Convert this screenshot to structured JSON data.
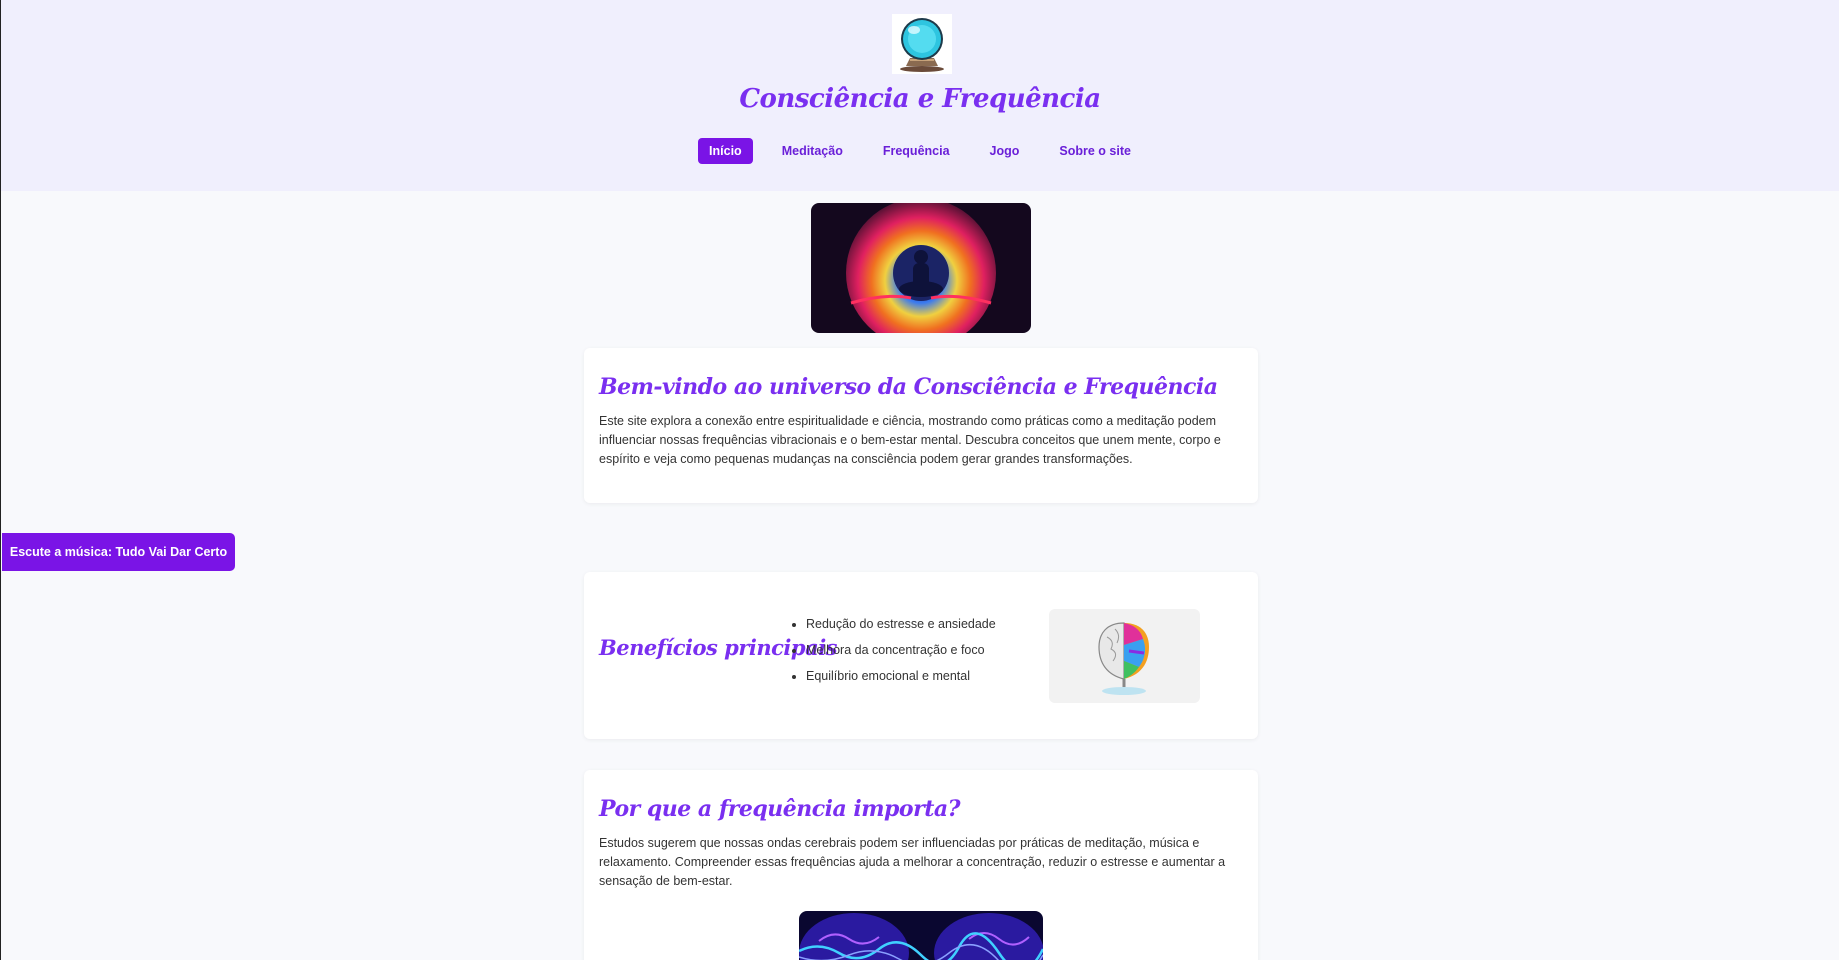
{
  "header": {
    "title": "Consciência e Frequência",
    "logo_icon": "crystal-ball-icon"
  },
  "nav": {
    "items": [
      {
        "label": "Início",
        "active": true
      },
      {
        "label": "Meditação",
        "active": false
      },
      {
        "label": "Frequência",
        "active": false
      },
      {
        "label": "Jogo",
        "active": false
      },
      {
        "label": "Sobre o site",
        "active": false
      }
    ]
  },
  "intro": {
    "title": "Bem-vindo ao universo da Consciência e Frequência",
    "text": "Este site explora a conexão entre espiritualidade e ciência, mostrando como práticas como a meditação podem influenciar nossas frequências vibracionais e o bem-estar mental. Descubra conceitos que unem mente, corpo e espírito e veja como pequenas mudanças na consciência podem gerar grandes transformações."
  },
  "benefits": {
    "title": "Benefícios principais",
    "items": [
      "Redução do estresse e ansiedade",
      "Melhora da concentração e foco",
      "Equilíbrio emocional e mental"
    ]
  },
  "frequency": {
    "title": "Por que a frequência importa?",
    "text": "Estudos sugerem que nossas ondas cerebrais podem ser influenciadas por práticas de meditação, música e relaxamento. Compreender essas frequências ajuda a melhorar a concentração, reduzir o estresse e aumentar a sensação de bem-estar."
  },
  "music_button": {
    "label": "Escute a música: Tudo Vai Dar Certo"
  },
  "colors": {
    "accent": "#7a14e6",
    "heading": "#7a2ff0",
    "header_bg": "#f0effd",
    "page_bg": "#f8f9fc"
  }
}
